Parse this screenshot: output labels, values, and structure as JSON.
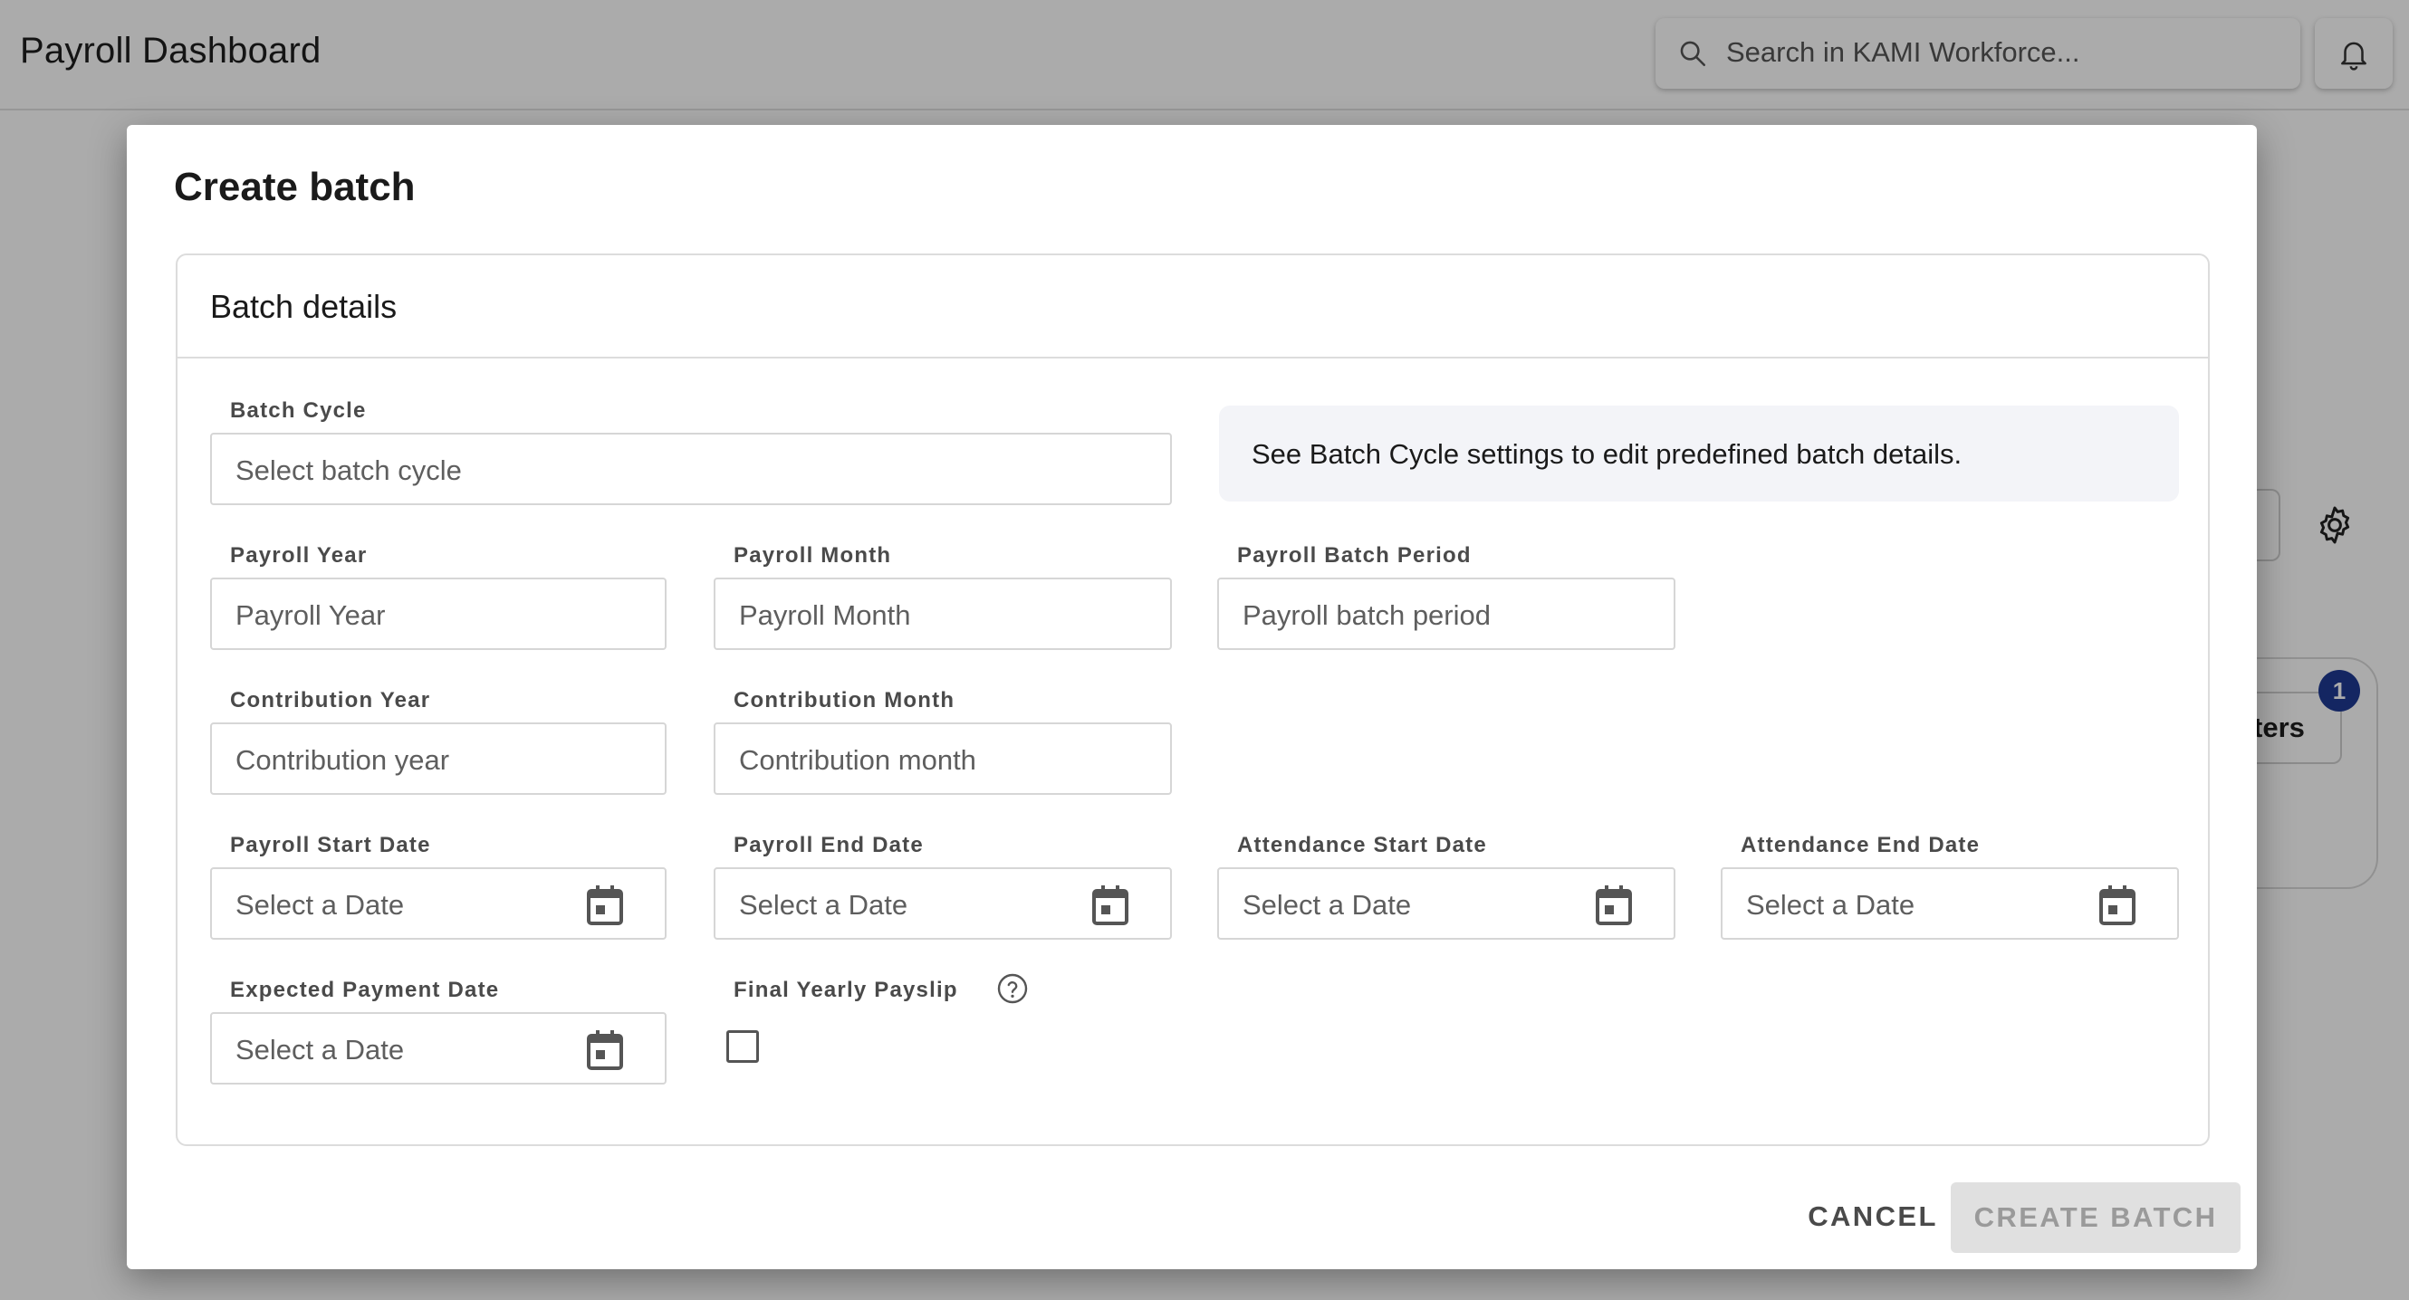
{
  "header": {
    "page_title": "Payroll Dashboard",
    "search_placeholder": "Search in KAMI Workforce..."
  },
  "background": {
    "filter_button_partial": "ters",
    "filter_badge_count": "1"
  },
  "modal": {
    "title": "Create batch",
    "section_title": "Batch details",
    "info_text": "See Batch Cycle settings to edit predefined batch details.",
    "fields": {
      "batch_cycle": {
        "label": "Batch Cycle",
        "placeholder": "Select batch cycle"
      },
      "payroll_year": {
        "label": "Payroll Year",
        "placeholder": "Payroll Year"
      },
      "payroll_month": {
        "label": "Payroll Month",
        "placeholder": "Payroll Month"
      },
      "payroll_batch_period": {
        "label": "Payroll Batch Period",
        "placeholder": "Payroll batch period"
      },
      "contribution_year": {
        "label": "Contribution Year",
        "placeholder": "Contribution year"
      },
      "contribution_month": {
        "label": "Contribution Month",
        "placeholder": "Contribution month"
      },
      "payroll_start_date": {
        "label": "Payroll Start Date",
        "placeholder": "Select a Date"
      },
      "payroll_end_date": {
        "label": "Payroll End Date",
        "placeholder": "Select a Date"
      },
      "attendance_start_date": {
        "label": "Attendance Start Date",
        "placeholder": "Select a Date"
      },
      "attendance_end_date": {
        "label": "Attendance End Date",
        "placeholder": "Select a Date"
      },
      "expected_payment_date": {
        "label": "Expected Payment Date",
        "placeholder": "Select a Date"
      },
      "final_yearly_payslip": {
        "label": "Final Yearly Payslip",
        "checked": false
      }
    },
    "actions": {
      "cancel_label": "CANCEL",
      "create_label": "CREATE BATCH",
      "create_disabled": true
    }
  },
  "icons": {
    "search": "search-icon",
    "bell": "bell-icon",
    "settings": "gear-icon",
    "calendar": "calendar-icon",
    "help": "help-circle-icon"
  },
  "colors": {
    "badge": "#1f3a93",
    "info_box": "#f3f4f8",
    "disabled_button": "#e0e0e0"
  }
}
